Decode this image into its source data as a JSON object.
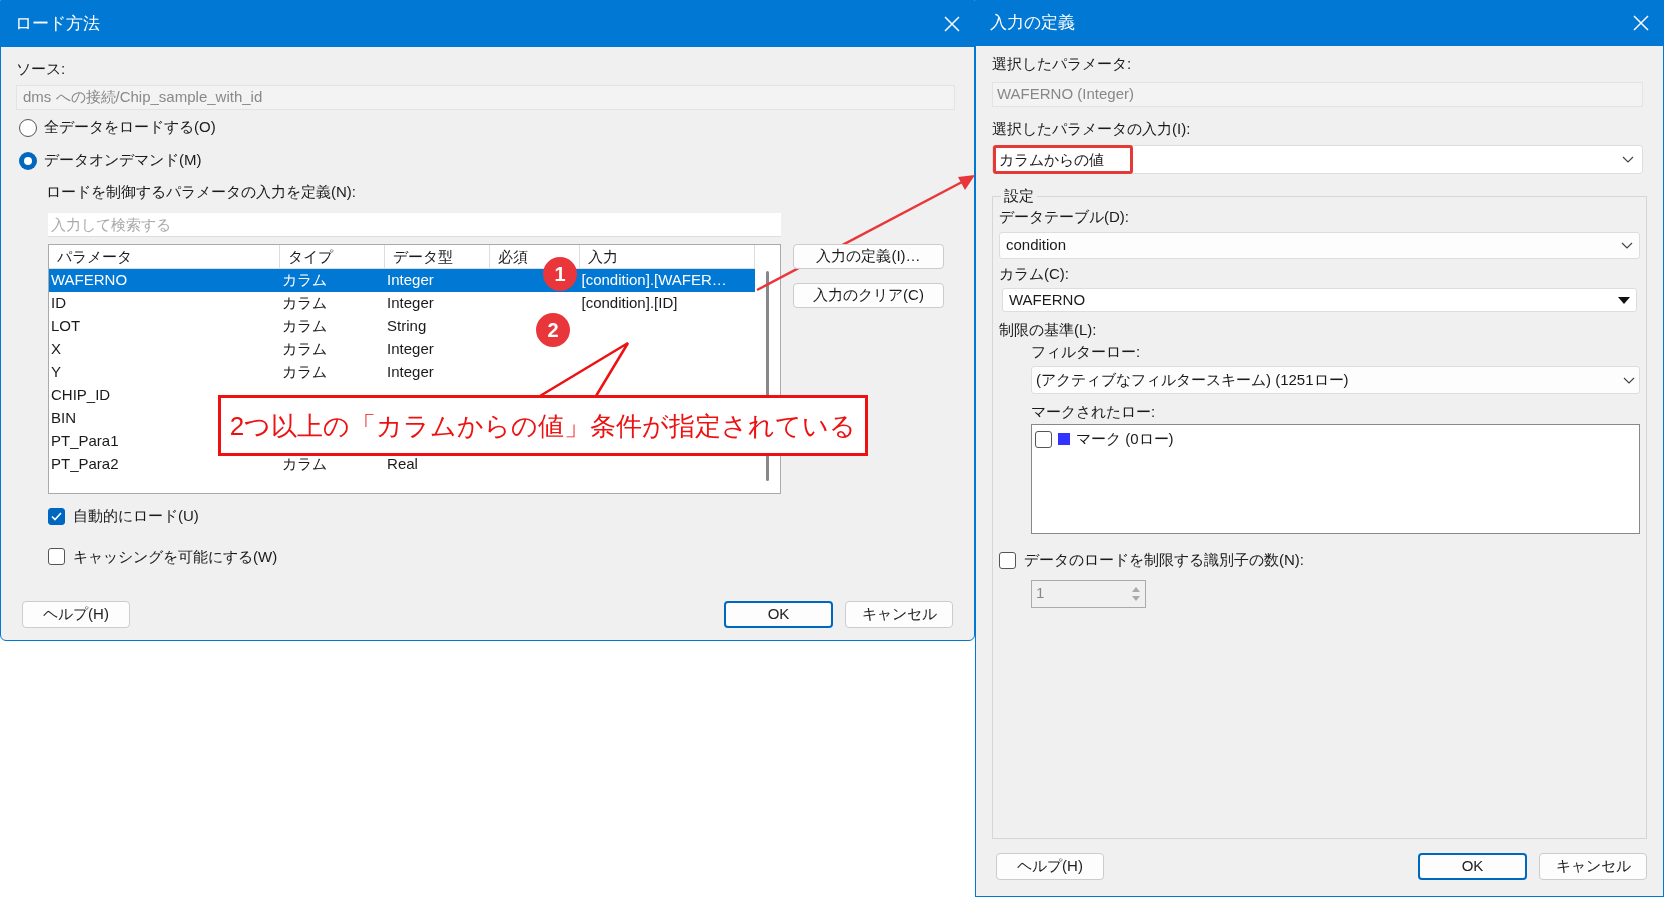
{
  "load_dialog": {
    "title": "ロード方法",
    "source_label": "ソース:",
    "source_value": "dms への接続/Chip_sample_with_id",
    "radios": [
      {
        "label": "全データをロードする(O)",
        "selected": false
      },
      {
        "label": "データオンデマンド(M)",
        "selected": true
      }
    ],
    "define_label": "ロードを制御するパラメータの入力を定義(N):",
    "search_placeholder": "入力して検索する",
    "table": {
      "columns": [
        "パラメータ",
        "タイプ",
        "データ型",
        "必須",
        "入力"
      ],
      "rows": [
        {
          "parameter": "WAFERNO",
          "type": "カラム",
          "data_type": "Integer",
          "input": "[condition].[WAFER…",
          "selected": true
        },
        {
          "parameter": "ID",
          "type": "カラム",
          "data_type": "Integer",
          "input": "[condition].[ID]",
          "selected": false
        },
        {
          "parameter": "LOT",
          "type": "カラム",
          "data_type": "String",
          "selected": false
        },
        {
          "parameter": "X",
          "type": "カラム",
          "data_type": "Integer",
          "selected": false
        },
        {
          "parameter": "Y",
          "type": "カラム",
          "data_type": "Integer",
          "selected": false
        },
        {
          "parameter": "CHIP_ID",
          "selected": false
        },
        {
          "parameter": "BIN",
          "selected": false
        },
        {
          "parameter": "PT_Para1",
          "selected": false
        },
        {
          "parameter": "PT_Para2",
          "type": "カラム",
          "data_type": "Real",
          "selected": false
        }
      ]
    },
    "side_buttons": [
      "入力の定義(I)…",
      "入力のクリア(C)"
    ],
    "checkboxes": [
      {
        "label": "自動的にロード(U)",
        "checked": true
      },
      {
        "label": "キャッシングを可能にする(W)",
        "checked": false
      }
    ],
    "buttons": [
      "ヘルプ(H)",
      "OK",
      "キャンセル"
    ]
  },
  "annotation": {
    "badges": [
      "1",
      "2"
    ],
    "callout": "2つ以上の「カラムからの値」条件が指定されている"
  },
  "define_dialog": {
    "title": "入力の定義",
    "selected_param_label": "選択したパラメータ:",
    "selected_param_value": "WAFERNO (Integer)",
    "input_label": "選択したパラメータの入力(I):",
    "input_value": "カラムからの値",
    "settings_title": "設定",
    "data_table_label": "データテーブル(D):",
    "data_table_value": "condition",
    "column_label": "カラム(C):",
    "column_value": "WAFERNO",
    "limit_label": "制限の基準(L):",
    "filter_rows_label": "フィルターロー:",
    "filter_rows_value": "(アクティブなフィルタースキーム) (1251ロー)",
    "marked_rows_label": "マークされたロー:",
    "marks": [
      {
        "label": "マーク (0ロー)",
        "checked": false,
        "color": "#3333ff"
      }
    ],
    "limit_checkbox": {
      "label": "データのロードを制限する識別子の数(N):",
      "checked": false
    },
    "spinner_value": "1",
    "buttons": [
      "ヘルプ(H)",
      "OK",
      "キャンセル"
    ]
  }
}
